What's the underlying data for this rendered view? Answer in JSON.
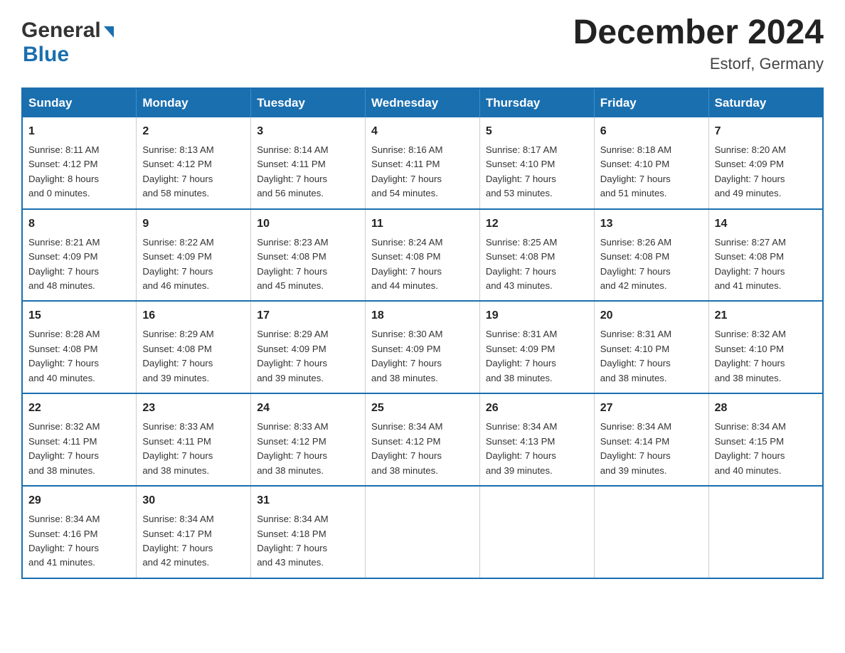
{
  "header": {
    "month_title": "December 2024",
    "location": "Estorf, Germany"
  },
  "logo": {
    "line1": "General",
    "line2": "Blue"
  },
  "days_of_week": [
    "Sunday",
    "Monday",
    "Tuesday",
    "Wednesday",
    "Thursday",
    "Friday",
    "Saturday"
  ],
  "weeks": [
    [
      {
        "day": "1",
        "sunrise": "8:11 AM",
        "sunset": "4:12 PM",
        "daylight": "8 hours and 0 minutes."
      },
      {
        "day": "2",
        "sunrise": "8:13 AM",
        "sunset": "4:12 PM",
        "daylight": "7 hours and 58 minutes."
      },
      {
        "day": "3",
        "sunrise": "8:14 AM",
        "sunset": "4:11 PM",
        "daylight": "7 hours and 56 minutes."
      },
      {
        "day": "4",
        "sunrise": "8:16 AM",
        "sunset": "4:11 PM",
        "daylight": "7 hours and 54 minutes."
      },
      {
        "day": "5",
        "sunrise": "8:17 AM",
        "sunset": "4:10 PM",
        "daylight": "7 hours and 53 minutes."
      },
      {
        "day": "6",
        "sunrise": "8:18 AM",
        "sunset": "4:10 PM",
        "daylight": "7 hours and 51 minutes."
      },
      {
        "day": "7",
        "sunrise": "8:20 AM",
        "sunset": "4:09 PM",
        "daylight": "7 hours and 49 minutes."
      }
    ],
    [
      {
        "day": "8",
        "sunrise": "8:21 AM",
        "sunset": "4:09 PM",
        "daylight": "7 hours and 48 minutes."
      },
      {
        "day": "9",
        "sunrise": "8:22 AM",
        "sunset": "4:09 PM",
        "daylight": "7 hours and 46 minutes."
      },
      {
        "day": "10",
        "sunrise": "8:23 AM",
        "sunset": "4:08 PM",
        "daylight": "7 hours and 45 minutes."
      },
      {
        "day": "11",
        "sunrise": "8:24 AM",
        "sunset": "4:08 PM",
        "daylight": "7 hours and 44 minutes."
      },
      {
        "day": "12",
        "sunrise": "8:25 AM",
        "sunset": "4:08 PM",
        "daylight": "7 hours and 43 minutes."
      },
      {
        "day": "13",
        "sunrise": "8:26 AM",
        "sunset": "4:08 PM",
        "daylight": "7 hours and 42 minutes."
      },
      {
        "day": "14",
        "sunrise": "8:27 AM",
        "sunset": "4:08 PM",
        "daylight": "7 hours and 41 minutes."
      }
    ],
    [
      {
        "day": "15",
        "sunrise": "8:28 AM",
        "sunset": "4:08 PM",
        "daylight": "7 hours and 40 minutes."
      },
      {
        "day": "16",
        "sunrise": "8:29 AM",
        "sunset": "4:08 PM",
        "daylight": "7 hours and 39 minutes."
      },
      {
        "day": "17",
        "sunrise": "8:29 AM",
        "sunset": "4:09 PM",
        "daylight": "7 hours and 39 minutes."
      },
      {
        "day": "18",
        "sunrise": "8:30 AM",
        "sunset": "4:09 PM",
        "daylight": "7 hours and 38 minutes."
      },
      {
        "day": "19",
        "sunrise": "8:31 AM",
        "sunset": "4:09 PM",
        "daylight": "7 hours and 38 minutes."
      },
      {
        "day": "20",
        "sunrise": "8:31 AM",
        "sunset": "4:10 PM",
        "daylight": "7 hours and 38 minutes."
      },
      {
        "day": "21",
        "sunrise": "8:32 AM",
        "sunset": "4:10 PM",
        "daylight": "7 hours and 38 minutes."
      }
    ],
    [
      {
        "day": "22",
        "sunrise": "8:32 AM",
        "sunset": "4:11 PM",
        "daylight": "7 hours and 38 minutes."
      },
      {
        "day": "23",
        "sunrise": "8:33 AM",
        "sunset": "4:11 PM",
        "daylight": "7 hours and 38 minutes."
      },
      {
        "day": "24",
        "sunrise": "8:33 AM",
        "sunset": "4:12 PM",
        "daylight": "7 hours and 38 minutes."
      },
      {
        "day": "25",
        "sunrise": "8:34 AM",
        "sunset": "4:12 PM",
        "daylight": "7 hours and 38 minutes."
      },
      {
        "day": "26",
        "sunrise": "8:34 AM",
        "sunset": "4:13 PM",
        "daylight": "7 hours and 39 minutes."
      },
      {
        "day": "27",
        "sunrise": "8:34 AM",
        "sunset": "4:14 PM",
        "daylight": "7 hours and 39 minutes."
      },
      {
        "day": "28",
        "sunrise": "8:34 AM",
        "sunset": "4:15 PM",
        "daylight": "7 hours and 40 minutes."
      }
    ],
    [
      {
        "day": "29",
        "sunrise": "8:34 AM",
        "sunset": "4:16 PM",
        "daylight": "7 hours and 41 minutes."
      },
      {
        "day": "30",
        "sunrise": "8:34 AM",
        "sunset": "4:17 PM",
        "daylight": "7 hours and 42 minutes."
      },
      {
        "day": "31",
        "sunrise": "8:34 AM",
        "sunset": "4:18 PM",
        "daylight": "7 hours and 43 minutes."
      },
      null,
      null,
      null,
      null
    ]
  ],
  "labels": {
    "sunrise": "Sunrise: ",
    "sunset": "Sunset: ",
    "daylight": "Daylight: "
  }
}
